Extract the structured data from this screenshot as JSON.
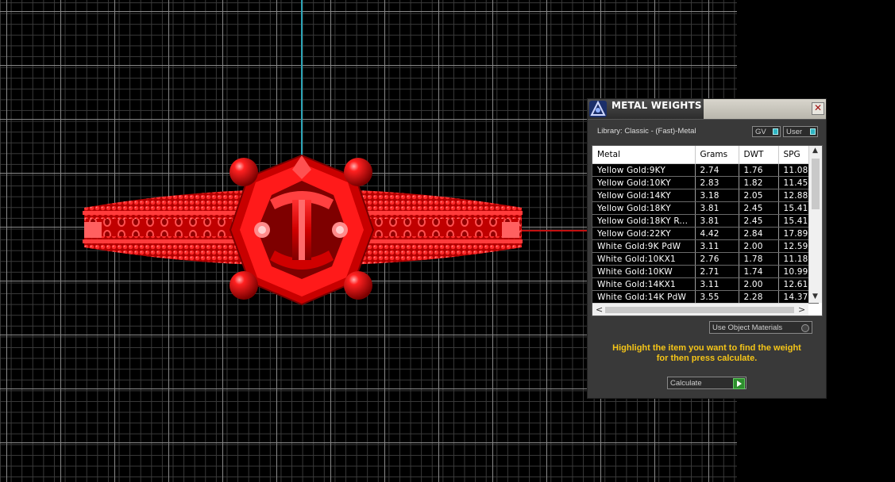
{
  "panel": {
    "title": "METAL WEIGHTS",
    "close_icon": "✕",
    "library": "Library: Classic - (Fast)-Metal",
    "toggles": {
      "gv": "GV",
      "user": "User"
    },
    "use_object_materials": "Use Object Materials",
    "hint_line1": "Highlight the item you want to find the weight",
    "hint_line2": "for then press calculate.",
    "calculate": "Calculate"
  },
  "table": {
    "columns": [
      "Metal",
      "Grams",
      "DWT",
      "SPG"
    ],
    "rows": [
      [
        "Yellow Gold:9KY",
        "2.74",
        "1.76",
        "11.08"
      ],
      [
        "Yellow Gold:10KY",
        "2.83",
        "1.82",
        "11.45"
      ],
      [
        "Yellow Gold:14KY",
        "3.18",
        "2.05",
        "12.88"
      ],
      [
        "Yellow Gold:18KY",
        "3.81",
        "2.45",
        "15.41"
      ],
      [
        "Yellow Gold:18KY R...",
        "3.81",
        "2.45",
        "15.41"
      ],
      [
        "Yellow Gold:22KY",
        "4.42",
        "2.84",
        "17.89"
      ],
      [
        "White Gold:9K PdW",
        "3.11",
        "2.00",
        "12.59"
      ],
      [
        "White Gold:10KX1",
        "2.76",
        "1.78",
        "11.18"
      ],
      [
        "White Gold:10KW",
        "2.71",
        "1.74",
        "10.99"
      ],
      [
        "White Gold:14KX1",
        "3.11",
        "2.00",
        "12.61"
      ],
      [
        "White Gold:14K PdW",
        "3.55",
        "2.28",
        "14.37"
      ]
    ]
  },
  "colors": {
    "model": "#e00000",
    "hint": "#f5c518",
    "axis_vertical": "#2aa3b6",
    "axis_horizontal": "#c41010"
  }
}
